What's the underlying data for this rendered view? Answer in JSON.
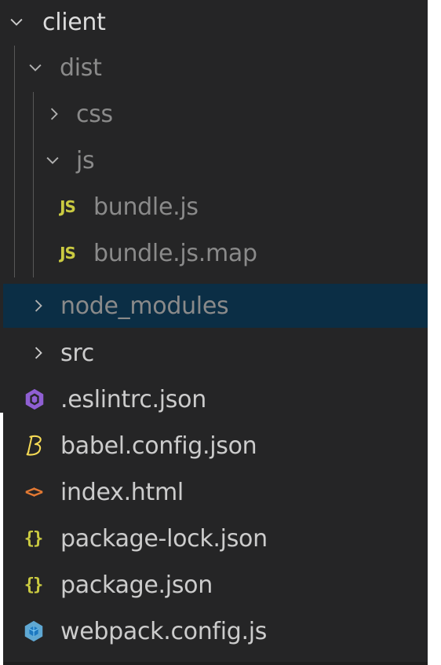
{
  "colors": {
    "panel_bg": "#252526",
    "selected_bg": "#0b2e45",
    "text": "#cccccc",
    "dim_text": "#8a8a8a",
    "js_yellow": "#cbcb41",
    "html_orange": "#e37933",
    "eslint_purple": "#8f5fd2",
    "webpack_blue": "#5fa8d3"
  },
  "tree": {
    "client": {
      "label": "client",
      "icon": "chevron-down-icon"
    },
    "dist": {
      "label": "dist",
      "icon": "chevron-down-icon"
    },
    "css": {
      "label": "css",
      "icon": "chevron-right-icon"
    },
    "js": {
      "label": "js",
      "icon": "chevron-down-icon"
    },
    "bundle_js": {
      "label": "bundle.js",
      "icon_text": "JS"
    },
    "bundle_js_map": {
      "label": "bundle.js.map",
      "icon_text": "JS"
    },
    "node_modules": {
      "label": "node_modules",
      "icon": "chevron-right-icon"
    },
    "src": {
      "label": "src",
      "icon": "chevron-right-icon"
    },
    "eslintrc": {
      "label": ".eslintrc.json",
      "icon": "eslint-icon"
    },
    "babel": {
      "label": "babel.config.json",
      "icon": "babel-icon"
    },
    "index_html": {
      "label": "index.html",
      "icon_text": "<>"
    },
    "package_lock": {
      "label": "package-lock.json",
      "icon_text": "{}"
    },
    "package_json": {
      "label": "package.json",
      "icon_text": "{}"
    },
    "webpack": {
      "label": "webpack.config.js",
      "icon": "webpack-icon"
    }
  }
}
